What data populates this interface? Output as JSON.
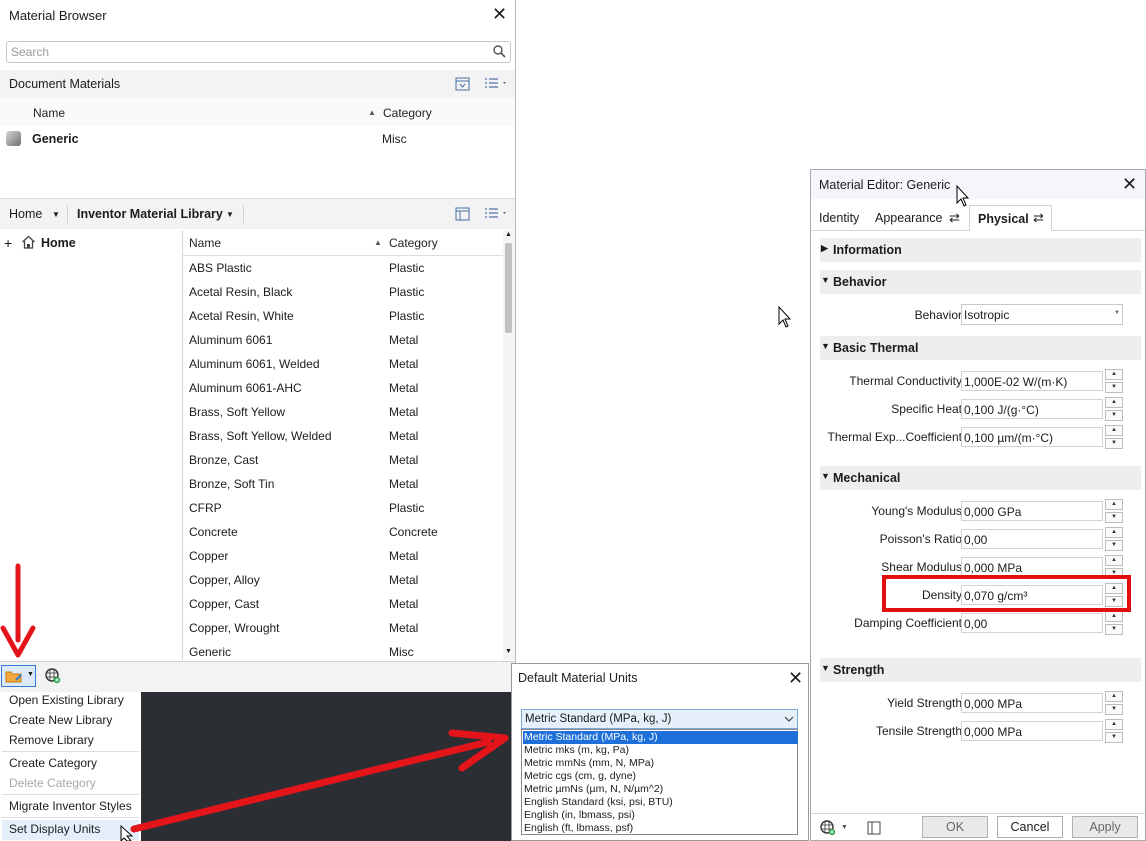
{
  "material_browser": {
    "title": "Material Browser",
    "search_placeholder": "Search",
    "document_materials_label": "Document Materials",
    "columns": {
      "name": "Name",
      "category": "Category"
    },
    "document_rows": [
      {
        "name": "Generic",
        "category": "Misc"
      }
    ],
    "nav": {
      "home_label": "Home",
      "library_label": "Inventor Material Library"
    },
    "tree_home": "Home",
    "library_rows": [
      {
        "name": "ABS Plastic",
        "category": "Plastic"
      },
      {
        "name": "Acetal Resin, Black",
        "category": "Plastic"
      },
      {
        "name": "Acetal Resin, White",
        "category": "Plastic"
      },
      {
        "name": "Aluminum 6061",
        "category": "Metal"
      },
      {
        "name": "Aluminum 6061, Welded",
        "category": "Metal"
      },
      {
        "name": "Aluminum 6061-AHC",
        "category": "Metal"
      },
      {
        "name": "Brass, Soft Yellow",
        "category": "Metal"
      },
      {
        "name": "Brass, Soft Yellow, Welded",
        "category": "Metal"
      },
      {
        "name": "Bronze, Cast",
        "category": "Metal"
      },
      {
        "name": "Bronze, Soft Tin",
        "category": "Metal"
      },
      {
        "name": "CFRP",
        "category": "Plastic"
      },
      {
        "name": "Concrete",
        "category": "Concrete"
      },
      {
        "name": "Copper",
        "category": "Metal"
      },
      {
        "name": "Copper, Alloy",
        "category": "Metal"
      },
      {
        "name": "Copper, Cast",
        "category": "Metal"
      },
      {
        "name": "Copper, Wrought",
        "category": "Metal"
      },
      {
        "name": "Generic",
        "category": "Misc"
      }
    ]
  },
  "context_menu": {
    "items": [
      {
        "label": "Open Existing Library",
        "enabled": true
      },
      {
        "label": "Create New Library",
        "enabled": true
      },
      {
        "label": "Remove Library",
        "enabled": true
      },
      {
        "label": "Create Category",
        "enabled": true
      },
      {
        "label": "Delete Category",
        "enabled": false
      },
      {
        "label": "Migrate Inventor Styles",
        "enabled": true
      },
      {
        "label": "Set Display Units",
        "enabled": true
      }
    ]
  },
  "units_dialog": {
    "title": "Default Material Units",
    "selected": "Metric Standard (MPa, kg, J)",
    "options": [
      "Metric Standard (MPa, kg, J)",
      "Metric mks (m, kg, Pa)",
      "Metric mmNs (mm, N, MPa)",
      "Metric cgs (cm, g, dyne)",
      "Metric µmNs (µm, N, N/µm^2)",
      "English Standard (ksi, psi, BTU)",
      "English (in, lbmass, psi)",
      "English (ft, lbmass, psf)"
    ]
  },
  "material_editor": {
    "title": "Material Editor: Generic",
    "tabs": [
      "Identity",
      "Appearance",
      "Physical"
    ],
    "active_tab": "Physical",
    "sections": {
      "information": "Information",
      "behavior": "Behavior",
      "basic_thermal": "Basic Thermal",
      "mechanical": "Mechanical",
      "strength": "Strength"
    },
    "behavior": {
      "label": "Behavior",
      "value": "Isotropic"
    },
    "thermal": [
      {
        "label": "Thermal Conductivity",
        "value": "1,000E-02 W/(m·K)"
      },
      {
        "label": "Specific Heat",
        "value": "0,100 J/(g·°C)"
      },
      {
        "label": "Thermal Exp...Coefficient",
        "value": "0,100 µm/(m·°C)"
      }
    ],
    "mechanical": [
      {
        "label": "Young's Modulus",
        "value": "0,000 GPa"
      },
      {
        "label": "Poisson's Ratio",
        "value": "0,00"
      },
      {
        "label": "Shear Modulus",
        "value": "0,000 MPa"
      },
      {
        "label": "Density",
        "value": "0,070 g/cm³"
      },
      {
        "label": "Damping Coefficient",
        "value": "0,00"
      }
    ],
    "strength": [
      {
        "label": "Yield Strength",
        "value": "0,000 MPa"
      },
      {
        "label": "Tensile Strength",
        "value": "0,000 MPa"
      }
    ],
    "buttons": {
      "ok": "OK",
      "cancel": "Cancel",
      "apply": "Apply"
    }
  },
  "colors": {
    "highlight_red": "#e01010",
    "selection_blue": "#1e6fd9",
    "arrow_red": "#e4141b"
  }
}
